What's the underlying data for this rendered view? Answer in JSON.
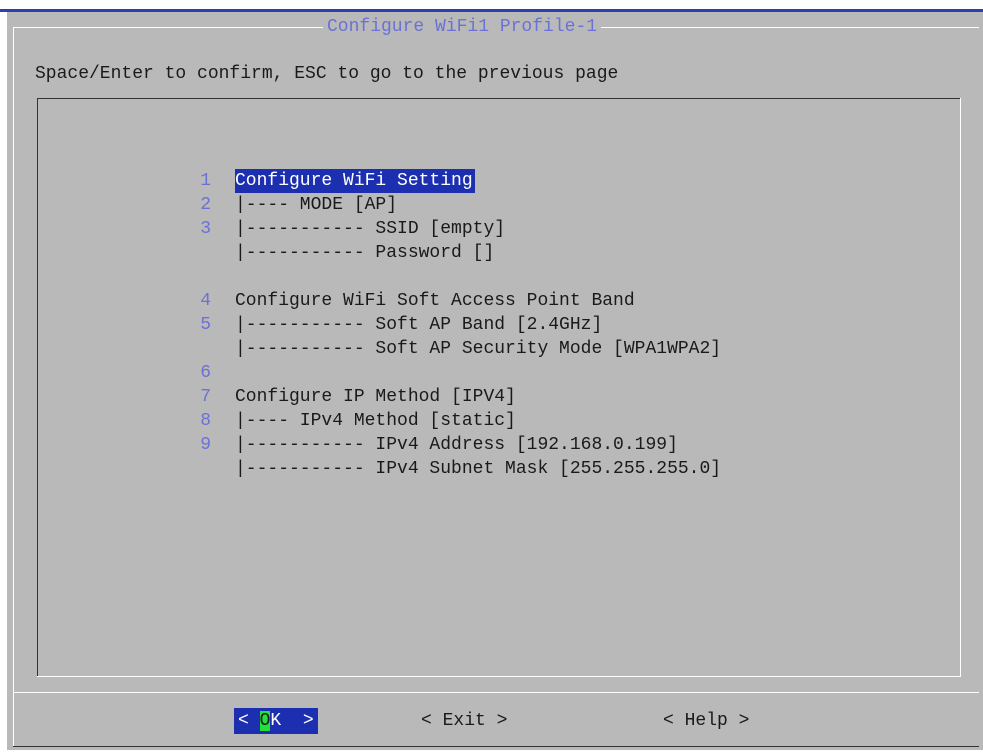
{
  "dialog": {
    "title": "Configure WiFi1 Profile-1",
    "instructions": "Space/Enter to confirm, ESC to go to the previous page"
  },
  "menu": {
    "items": [
      {
        "num": "",
        "text": "Configure WiFi Setting",
        "selected": true
      },
      {
        "num": "1",
        "text": "|---- MODE [AP]"
      },
      {
        "num": "2",
        "text": "|----------- SSID [empty]"
      },
      {
        "num": "3",
        "text": "|----------- Password []"
      },
      {
        "num": "",
        "text": ""
      },
      {
        "num": "",
        "text": "Configure WiFi Soft Access Point Band"
      },
      {
        "num": "4",
        "text": "|----------- Soft AP Band [2.4GHz]"
      },
      {
        "num": "5",
        "text": "|----------- Soft AP Security Mode [WPA1WPA2]"
      },
      {
        "num": "",
        "text": ""
      },
      {
        "num": "6",
        "text": "Configure IP Method [IPV4]"
      },
      {
        "num": "7",
        "text": "|---- IPv4 Method [static]"
      },
      {
        "num": "8",
        "text": "|----------- IPv4 Address [192.168.0.199]"
      },
      {
        "num": "9",
        "text": "|----------- IPv4 Subnet Mask [255.255.255.0]"
      }
    ]
  },
  "buttons": {
    "ok_open": "< ",
    "ok_hot": "O",
    "ok_rest": "K  >",
    "exit": "< Exit >",
    "help": "< Help >"
  },
  "colors": {
    "background": "#b9b9b9",
    "selection": "#1c2fb0",
    "hotkey": "#22e039",
    "accent": "#6b71d6"
  }
}
